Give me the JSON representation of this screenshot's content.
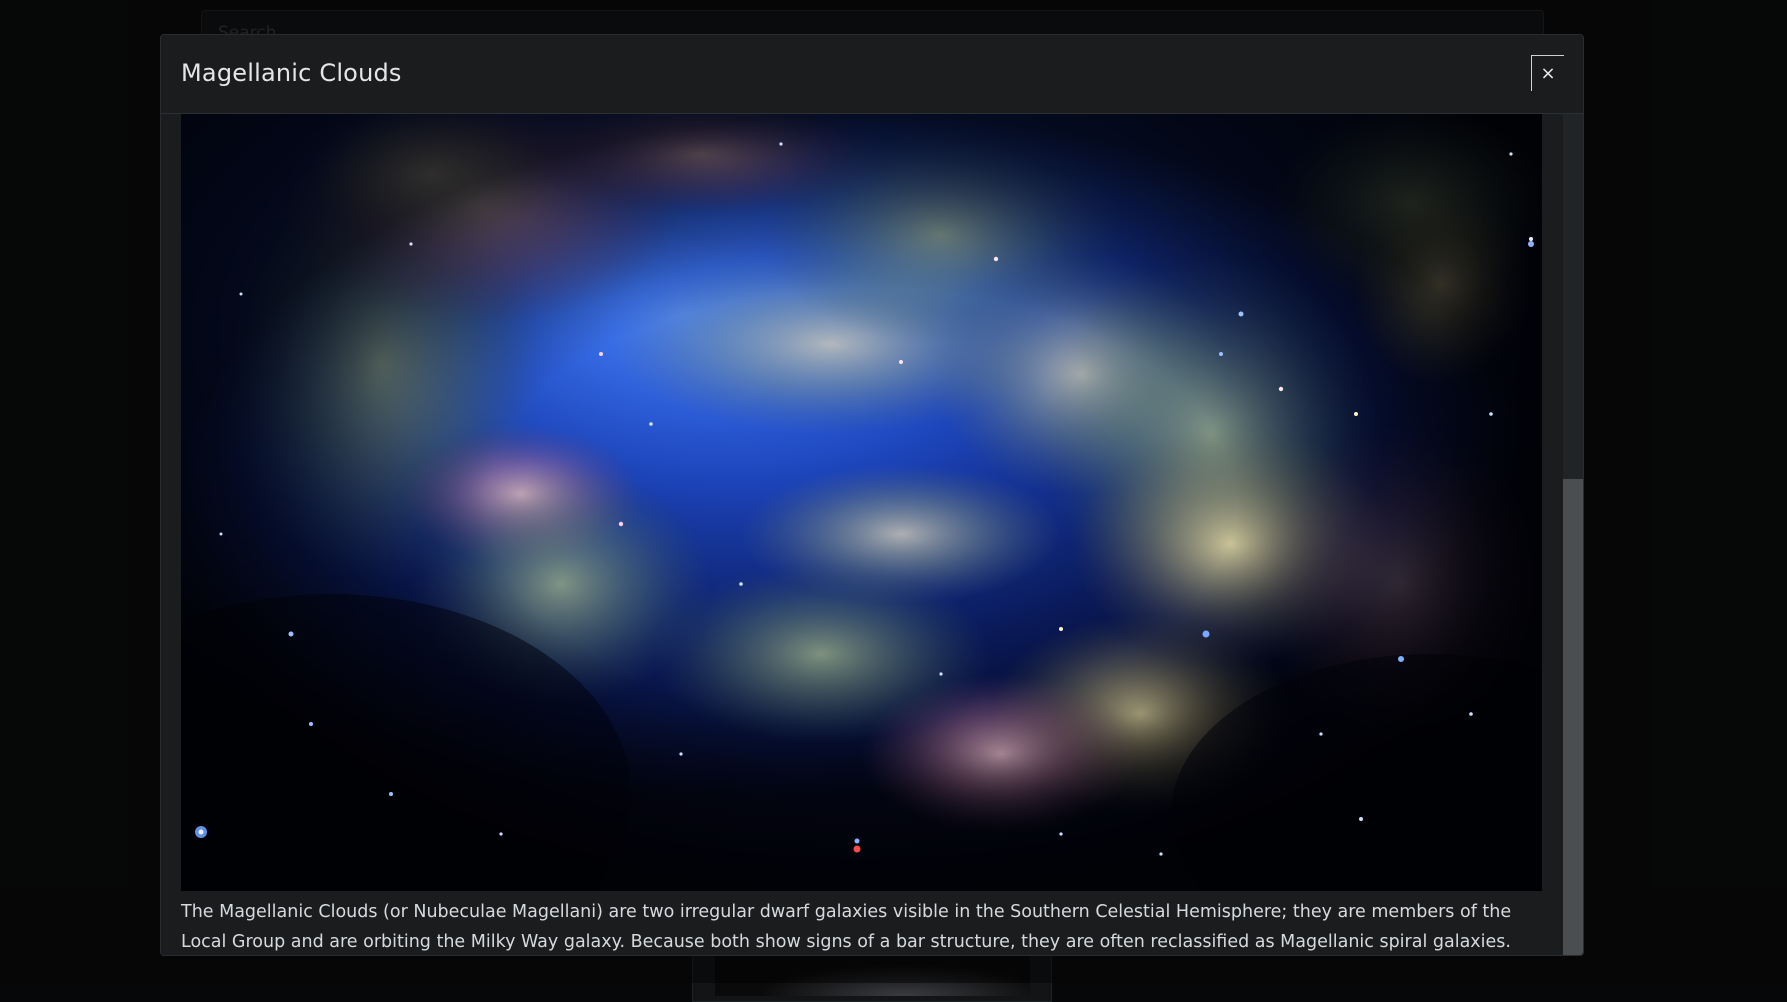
{
  "background": {
    "search_placeholder": "Search"
  },
  "modal": {
    "title": "Magellanic Clouds",
    "close_label": "×",
    "image_alt": "Large Magellanic Cloud infrared image",
    "description": "The Magellanic Clouds (or Nubeculae Magellani) are two irregular dwarf galaxies visible in the Southern Celestial Hemisphere; they are members of the Local Group and are orbiting the Milky Way galaxy. Because both show signs of a bar structure, they are often reclassified as Magellanic spiral galaxies."
  },
  "colors": {
    "modal_bg": "#1a1c1e",
    "text": "#d7dadd",
    "space_dark": "#03071a",
    "nebula_blue": "#1f4fd1",
    "dust_green": "#8fa07a",
    "dust_pink": "#c98aa2"
  }
}
